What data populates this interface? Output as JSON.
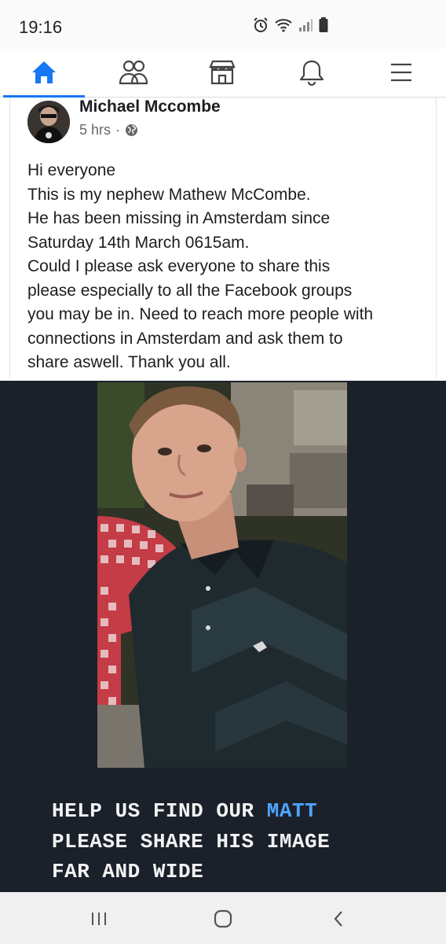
{
  "status_bar": {
    "time": "19:16",
    "icons": [
      "alarm-icon",
      "wifi-icon",
      "signal-icon",
      "battery-icon"
    ]
  },
  "nav": {
    "items": [
      {
        "name": "home",
        "icon": "home-icon",
        "active": true
      },
      {
        "name": "friends",
        "icon": "friends-icon",
        "active": false
      },
      {
        "name": "marketplace",
        "icon": "marketplace-icon",
        "active": false
      },
      {
        "name": "notifications",
        "icon": "bell-icon",
        "active": false
      },
      {
        "name": "menu",
        "icon": "menu-icon",
        "active": false
      }
    ],
    "accent_color": "#1877f2"
  },
  "post": {
    "author": "Michael Mccombe",
    "time_ago": "5 hrs",
    "separator": "·",
    "privacy_icon": "globe-icon",
    "text_lines": [
      "Hi everyone",
      "This is my nephew Mathew McCombe.",
      "He has been missing in Amsterdam since",
      "Saturday 14th March 0615am.",
      "Could I please ask everyone to share this",
      "please especially to all the Facebook groups",
      "you may be in. Need to reach more people with",
      "connections in Amsterdam and ask them to",
      "share aswell. Thank you all."
    ],
    "image": {
      "caption_line1_a": "HELP US FIND OUR ",
      "caption_line1_b": "MATT",
      "caption_line2": "PLEASE SHARE HIS IMAGE",
      "caption_line3": "FAR AND WIDE",
      "highlight_color": "#4ea4ff"
    }
  },
  "android_nav": {
    "buttons": [
      "recents-icon",
      "home-button-icon",
      "back-icon"
    ]
  }
}
